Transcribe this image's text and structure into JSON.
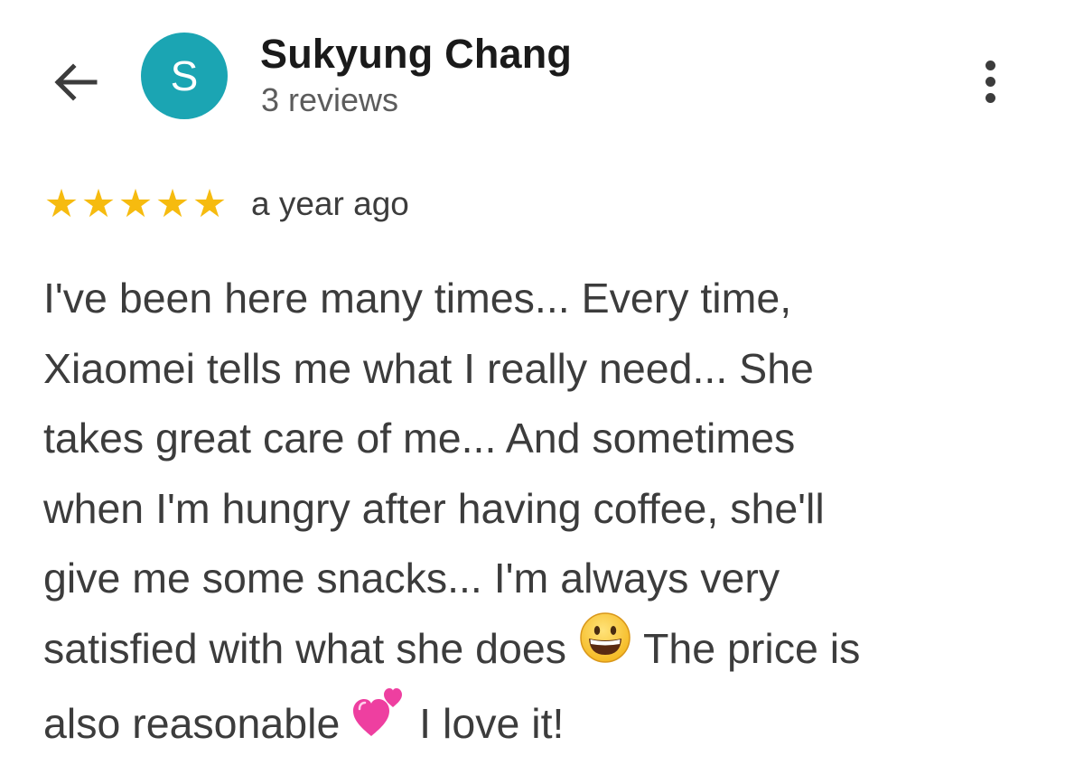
{
  "header": {
    "back_icon": "arrow-left-icon",
    "avatar_letter": "S",
    "avatar_color": "#1ba5b3",
    "author_name": "Sukyung Chang",
    "review_count": "3 reviews",
    "more_icon": "more-vert-icon"
  },
  "review": {
    "rating": 5,
    "rating_max": 5,
    "star_color": "#f6bb0f",
    "date": "a year ago",
    "lines": [
      "I've been here many times... Every time,",
      "Xiaomei tells me what I really need... She",
      "takes great care of me... And sometimes",
      "when I'm hungry after having coffee, she'll",
      "give me some snacks... I'm always very",
      "satisfied with what she does",
      "The price is",
      "also reasonable",
      "I love it!"
    ],
    "emoji_icons": [
      "grinning-face-emoji-icon",
      "two-hearts-emoji-icon"
    ]
  }
}
